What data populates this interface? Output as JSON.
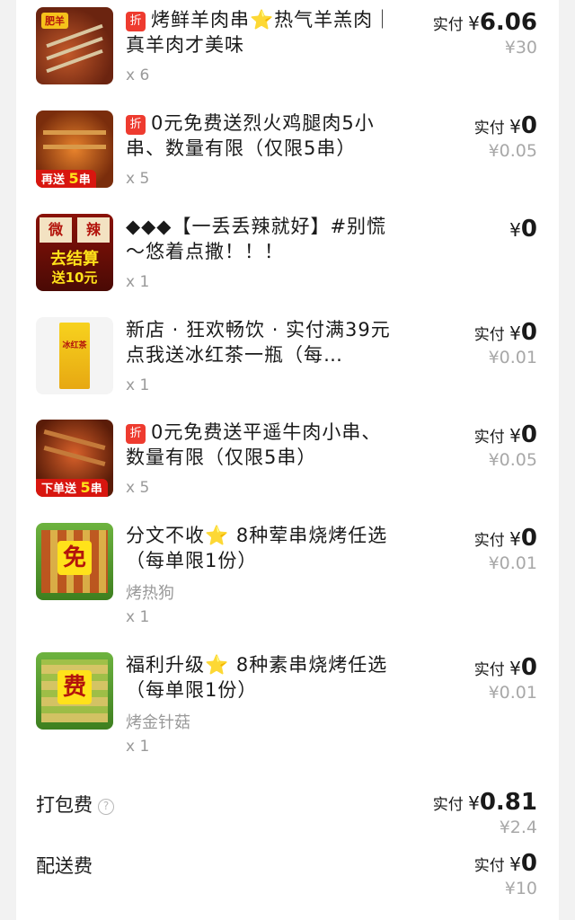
{
  "items": [
    {
      "badge": "折",
      "title_a": "烤鲜羊肉串",
      "title_b": "热气羊羔肉｜真羊肉才美味",
      "star": "⭐",
      "pay_label": "实付",
      "currency": "¥",
      "pay_value": "6.06",
      "original": "¥30",
      "qty": "x 6",
      "thumb_label": "肥羊"
    },
    {
      "badge": "折",
      "title": "0元免费送烈火鸡腿肉5小串、数量有限（仅限5串）",
      "pay_label": "实付",
      "currency": "¥",
      "pay_value": "0",
      "original": "¥0.05",
      "qty": "x 5",
      "thumb_caption_a": "再送",
      "thumb_caption_b": "5",
      "thumb_caption_c": "串"
    },
    {
      "title": "◆◆◆【一丢丢辣就好】#别慌～悠着点撒！！！",
      "currency": "¥",
      "pay_value": "0",
      "qty": "x 1",
      "thumb_top_a": "微",
      "thumb_top_b": "辣",
      "thumb_mid": "去结算",
      "thumb_bottom": "送10元"
    },
    {
      "title": "新店 · 狂欢畅饮 · 实付满39元点我送冰红茶一瓶（每…",
      "pay_label": "实付",
      "currency": "¥",
      "pay_value": "0",
      "original": "¥0.01",
      "qty": "x 1",
      "thumb_label": "冰红茶"
    },
    {
      "badge": "折",
      "title": "0元免费送平遥牛肉小串、数量有限（仅限5串）",
      "pay_label": "实付",
      "currency": "¥",
      "pay_value": "0",
      "original": "¥0.05",
      "qty": "x 5",
      "thumb_caption_a": "下单送",
      "thumb_caption_b": "5",
      "thumb_caption_c": "串"
    },
    {
      "title_a": "分文不收",
      "title_b": " 8种荤串烧烤任选（每单限1份）",
      "star": "⭐",
      "sub": "烤热狗",
      "pay_label": "实付",
      "currency": "¥",
      "pay_value": "0",
      "original": "¥0.01",
      "qty": "x 1",
      "thumb_label": "免"
    },
    {
      "title_a": "福利升级",
      "title_b": " 8种素串烧烤任选（每单限1份）",
      "star": "⭐",
      "sub": "烤金针菇",
      "pay_label": "实付",
      "currency": "¥",
      "pay_value": "0",
      "original": "¥0.01",
      "qty": "x 1",
      "thumb_label": "费"
    }
  ],
  "fees": {
    "packing": {
      "label": "打包费",
      "help_icon": "?",
      "pay_label": "实付",
      "currency": "¥",
      "pay_value": "0.81",
      "original": "¥2.4"
    },
    "delivery": {
      "label": "配送费",
      "pay_label": "实付",
      "currency": "¥",
      "pay_value": "0",
      "original": "¥10"
    }
  },
  "colors": {
    "badge": "#ee3b2f",
    "star": "#f7b500",
    "muted": "#9a9a9a"
  }
}
